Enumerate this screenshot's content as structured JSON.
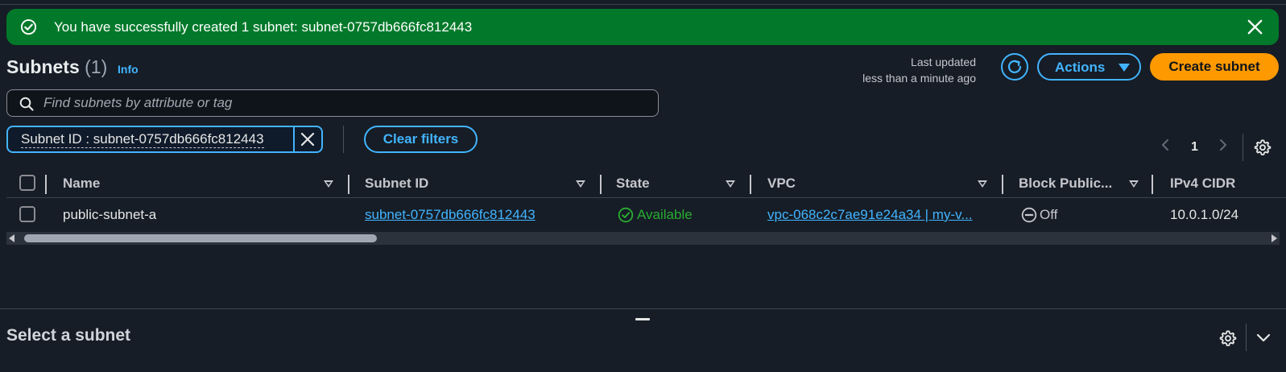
{
  "flash": {
    "message": "You have successfully created 1 subnet: subnet-0757db666fc812443",
    "type": "success",
    "color": "#02792a"
  },
  "header": {
    "title": "Subnets",
    "count": "(1)",
    "info": "Info",
    "last_updated_line1": "Last updated",
    "last_updated_line2": "less than a minute ago",
    "actions_label": "Actions",
    "create_label": "Create subnet"
  },
  "search": {
    "placeholder": "Find subnets by attribute or tag",
    "value": ""
  },
  "filter": {
    "token": "Subnet ID : subnet-0757db666fc812443",
    "clear_label": "Clear filters"
  },
  "pagination": {
    "current_page": "1"
  },
  "table": {
    "columns": [
      "Name",
      "Subnet ID",
      "State",
      "VPC",
      "Block Public...",
      "IPv4 CIDR"
    ],
    "rows": [
      {
        "name": "public-subnet-a",
        "subnet_id": "subnet-0757db666fc812443",
        "state": "Available",
        "vpc": "vpc-068c2c7ae91e24a34 | my-v...",
        "block_public": "Off",
        "ipv4_cidr": "10.0.1.0/24"
      }
    ]
  },
  "split_panel": {
    "title": "Select a subnet"
  },
  "colors": {
    "background": "#161d26",
    "accent": "#42b4ff",
    "primary_button": "#ff9900",
    "success": "#29ad32"
  }
}
